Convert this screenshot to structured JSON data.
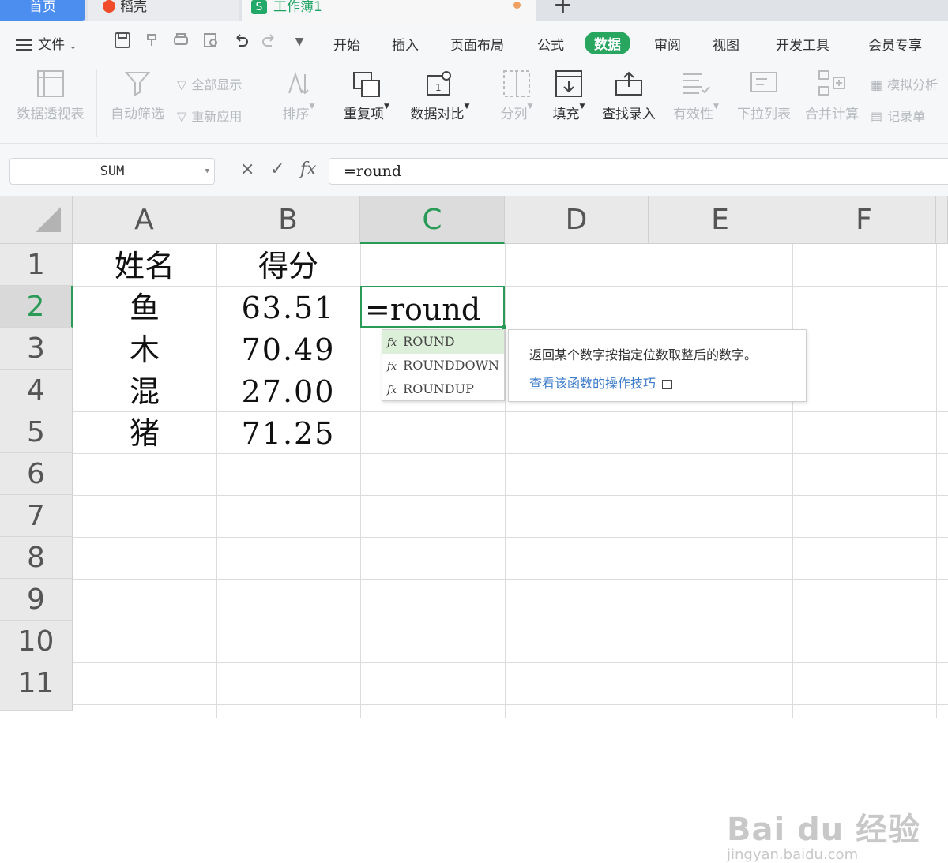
{
  "tabs": {
    "home": "首页",
    "docer": "稻壳",
    "workbook": "工作簿1",
    "workbook_icon": "S",
    "new_tab": "+"
  },
  "menu": {
    "file": "文件",
    "items": [
      "开始",
      "插入",
      "页面布局",
      "公式",
      "数据",
      "审阅",
      "视图",
      "开发工具",
      "会员专享"
    ],
    "active": "数据"
  },
  "ribbon": {
    "pivot_table": "数据透视表",
    "auto_filter": "自动筛选",
    "show_all": "全部显示",
    "reapply": "重新应用",
    "sort": "排序",
    "duplicates": "重复项",
    "data_compare": "数据对比",
    "split_column": "分列",
    "fill": "填充",
    "find_entry": "查找录入",
    "validity": "有效性",
    "dropdown_list": "下拉列表",
    "consolidate": "合并计算",
    "simulation": "模拟分析",
    "record_form": "记录单"
  },
  "formula_bar": {
    "name_box": "SUM",
    "cancel": "×",
    "confirm": "✓",
    "fx": "fx",
    "content": "=round"
  },
  "sheet": {
    "columns": [
      "A",
      "B",
      "C",
      "D",
      "E",
      "F"
    ],
    "rows": [
      "1",
      "2",
      "3",
      "4",
      "5",
      "6",
      "7",
      "8",
      "9",
      "10",
      "11"
    ],
    "selected_column": "C",
    "selected_row": "2",
    "cells": {
      "A1": "姓名",
      "B1": "得分",
      "A2": "鱼",
      "B2": "63.51",
      "A3": "木",
      "B3": "70.49",
      "A4": "混",
      "B4": "27.00",
      "A5": "猪",
      "B5": "71.25"
    },
    "editing_cell": "C2",
    "editing_text": "=round"
  },
  "autocomplete": {
    "fx_label": "fx",
    "items": [
      "ROUND",
      "ROUNDDOWN",
      "ROUNDUP"
    ],
    "highlighted": "ROUND",
    "tooltip": {
      "description": "返回某个数字按指定位数取整后的数字。",
      "link": "查看该函数的操作技巧"
    }
  },
  "watermark": {
    "brand": "Bai du 经验",
    "url": "jingyan.baidu.com"
  },
  "colors": {
    "accent_green": "#2a9a57",
    "home_tab_blue": "#4b8ef0",
    "link_blue": "#3d7cc9"
  }
}
